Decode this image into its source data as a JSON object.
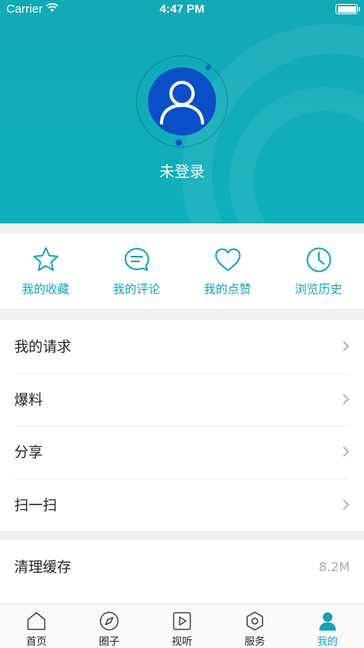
{
  "status_bar": {
    "carrier": "Carrier",
    "time": "4:47 PM"
  },
  "profile": {
    "login_label": "未登录"
  },
  "quick_actions": [
    {
      "icon": "star-icon",
      "label": "我的收藏"
    },
    {
      "icon": "comment-icon",
      "label": "我的评论"
    },
    {
      "icon": "heart-icon",
      "label": "我的点赞"
    },
    {
      "icon": "clock-icon",
      "label": "浏览历史"
    }
  ],
  "menu": [
    {
      "label": "我的请求"
    },
    {
      "label": "爆料"
    },
    {
      "label": "分享"
    },
    {
      "label": "扫一扫"
    }
  ],
  "cache": {
    "label": "清理缓存",
    "value": "8.2M"
  },
  "tabs": [
    {
      "icon": "home-icon",
      "label": "首页"
    },
    {
      "icon": "compass-icon",
      "label": "圈子"
    },
    {
      "icon": "play-icon",
      "label": "视听"
    },
    {
      "icon": "hexagon-icon",
      "label": "服务"
    },
    {
      "icon": "user-icon",
      "label": "我的"
    }
  ],
  "colors": {
    "accent": "#16a3b4",
    "header": "#12a9b6",
    "avatar": "#0b4fc8"
  }
}
